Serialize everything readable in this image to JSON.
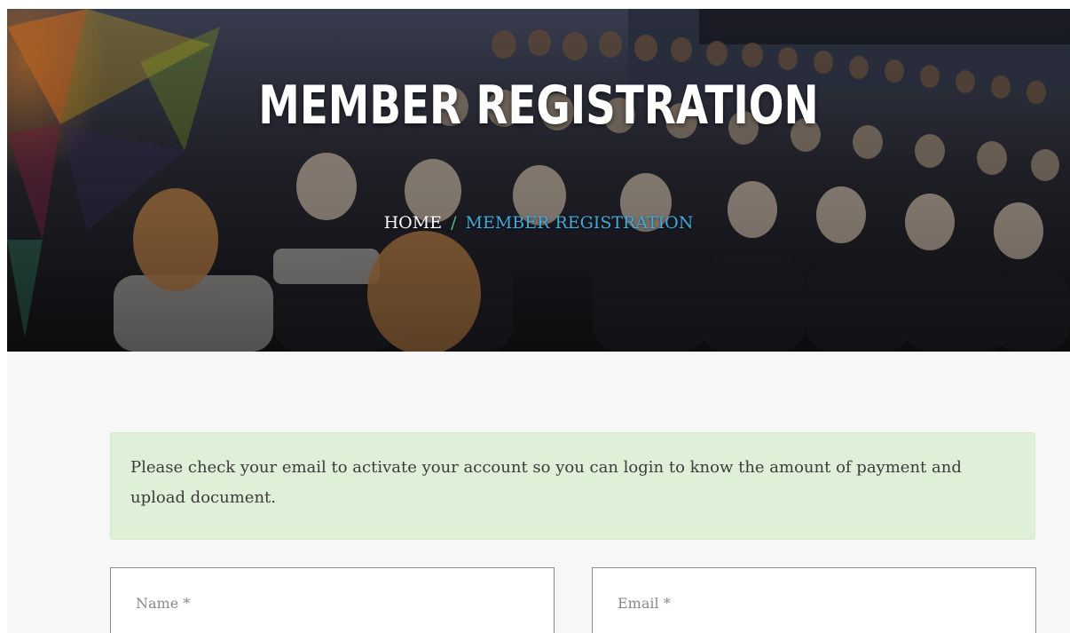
{
  "hero": {
    "title": "MEMBER REGISTRATION",
    "breadcrumb": {
      "home": "HOME",
      "separator": "/",
      "current": "MEMBER REGISTRATION"
    }
  },
  "alert": {
    "message": "Please check your email to activate your account so you can login to know the amount of payment and upload document."
  },
  "form": {
    "name_placeholder": "Name *",
    "email_placeholder": "Email *"
  },
  "colors": {
    "breadcrumb_current": "#3fa9de",
    "breadcrumb_separator": "#58c38a",
    "alert_background": "#dff0d8"
  }
}
